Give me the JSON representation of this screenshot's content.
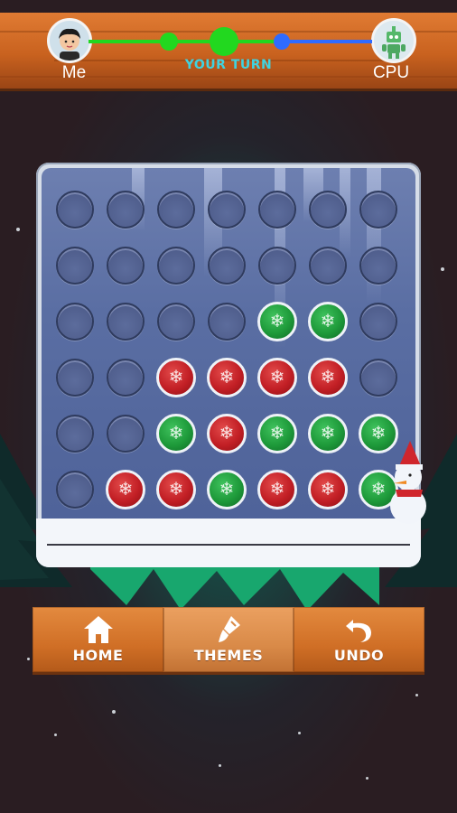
{
  "header": {
    "player_name": "Me",
    "opponent_name": "CPU",
    "turn_status": "YOUR TURN"
  },
  "board": {
    "rows": [
      [
        "",
        "",
        "",
        "",
        "",
        "",
        ""
      ],
      [
        "",
        "",
        "",
        "",
        "",
        "",
        ""
      ],
      [
        "",
        "",
        "",
        "",
        "green",
        "green",
        ""
      ],
      [
        "",
        "",
        "red",
        "red",
        "red",
        "red",
        ""
      ],
      [
        "",
        "",
        "green",
        "red",
        "green",
        "green",
        "green"
      ],
      [
        "",
        "red",
        "red",
        "green",
        "red",
        "red",
        "green"
      ]
    ]
  },
  "colors": {
    "player_disc": "#c21f25",
    "cpu_disc": "#1e9a3a",
    "turn_text": "#3fd3e0",
    "progress_me": "#22d81f",
    "progress_cpu": "#2f6bff"
  },
  "icons": {
    "disc_pattern": "snowflake-icon",
    "home": "home-icon",
    "themes": "paintbrush-icon",
    "undo": "undo-icon"
  },
  "controls": {
    "home_label": "HOME",
    "themes_label": "THEMES",
    "undo_label": "UNDO"
  }
}
